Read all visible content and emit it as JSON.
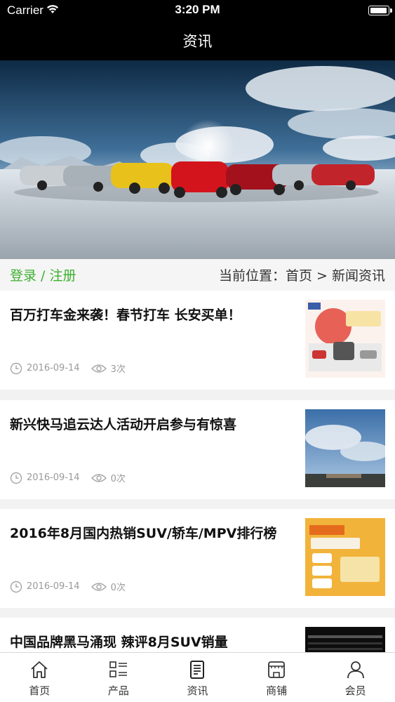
{
  "status_bar": {
    "carrier": "Carrier",
    "time": "3:20 PM",
    "battery_level": 1.0
  },
  "nav": {
    "title": "资讯"
  },
  "account": {
    "login": "登录",
    "separator": " / ",
    "register": "注册"
  },
  "breadcrumb": {
    "label": "当前位置：",
    "home": "首页",
    "separator": " > ",
    "current": "新闻资讯"
  },
  "news": [
    {
      "title": "百万打车金来袭！春节打车 长安买单！",
      "date": "2016-09-14",
      "views": "3次"
    },
    {
      "title": "新兴快马追云达人活动开启参与有惊喜",
      "date": "2016-09-14",
      "views": "0次"
    },
    {
      "title": "2016年8月国内热销SUV/轿车/MPV排行榜",
      "date": "2016-09-14",
      "views": "0次"
    },
    {
      "title": "中国品牌黑马涌现 辣评8月SUV销量",
      "date": "",
      "views": ""
    }
  ],
  "tabbar": [
    {
      "label": "首页",
      "icon": "home-icon"
    },
    {
      "label": "产品",
      "icon": "product-grid-icon"
    },
    {
      "label": "资讯",
      "icon": "news-document-icon"
    },
    {
      "label": "商铺",
      "icon": "store-icon"
    },
    {
      "label": "会员",
      "icon": "user-icon"
    }
  ],
  "colors": {
    "accent": "#3db02f",
    "bar": "#000000",
    "text": "#111111",
    "meta": "#9a9a9a"
  }
}
